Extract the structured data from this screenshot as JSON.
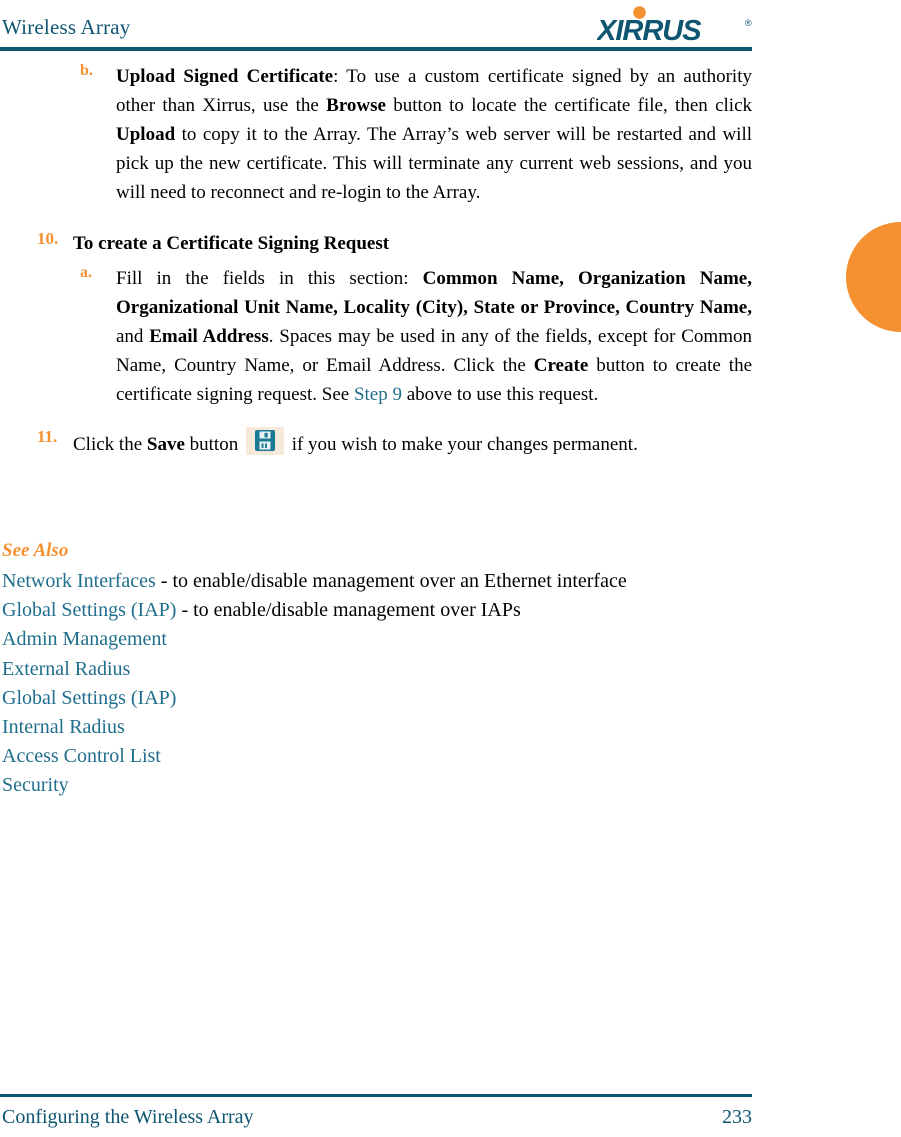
{
  "header": {
    "title": "Wireless Array",
    "logo_text": "XIRRUS",
    "logo_trademark": "®",
    "brand_teal": "#0d5570",
    "brand_orange": "#f4902f"
  },
  "steps": {
    "item_b": {
      "marker": "b.",
      "bold_lead": "Upload Signed Certificate",
      "text_part1": ": To use a custom certificate signed by an authority other than Xirrus, use the ",
      "bold_browse": "Browse",
      "text_part2": " button to locate the certificate file, then click ",
      "bold_upload": "Upload",
      "text_part3": " to copy it to the Array. The Array’s web server will be restarted and will pick up the new certificate. This will terminate any current web sessions, and you will need to reconnect and re-login to the Array."
    },
    "item_10": {
      "marker": "10.",
      "heading": "To create a Certificate Signing Request"
    },
    "item_10a": {
      "marker": "a.",
      "text_part1": "Fill in the fields in this section: ",
      "bold_fields": "Common Name, Organization Name, Organizational Unit Name, Locality (City), State or Province, Country Name,",
      "text_and": " and ",
      "bold_email": "Email Address",
      "text_part2": ". Spaces may be used in any of the fields, except for Common Name, Country Name, or Email Address. Click the ",
      "bold_create": "Create",
      "text_part3": " button to create the certificate signing request. See ",
      "link_step9": "Step 9",
      "text_part4": " above to use this request."
    },
    "item_11": {
      "marker": "11.",
      "text_part1": "Click the ",
      "bold_save": "Save",
      "text_part2": " button ",
      "icon": "save-floppy-icon",
      "text_part3": " if you wish to make your changes permanent."
    }
  },
  "see_also": {
    "heading": "See Also",
    "links": [
      {
        "label": "Network Interfaces",
        "desc": " - to enable/disable management over an Ethernet interface"
      },
      {
        "label": "Global Settings (IAP)",
        "desc": " - to enable/disable management over IAPs"
      },
      {
        "label": "Admin Management",
        "desc": ""
      },
      {
        "label": "External Radius",
        "desc": ""
      },
      {
        "label": "Global Settings (IAP)",
        "desc": ""
      },
      {
        "label": "Internal Radius",
        "desc": ""
      },
      {
        "label": "Access Control List",
        "desc": ""
      },
      {
        "label": "Security",
        "desc": ""
      }
    ]
  },
  "footer": {
    "title": "Configuring the Wireless Array",
    "page_number": "233"
  }
}
